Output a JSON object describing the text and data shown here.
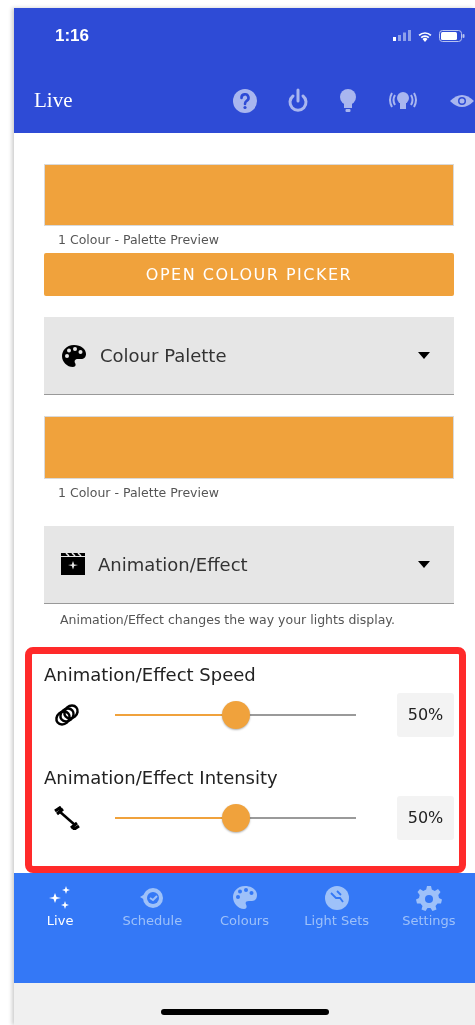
{
  "status_bar": {
    "time": "1:16"
  },
  "header": {
    "title": "Live"
  },
  "colour_preview": {
    "caption": "1 Colour - Palette Preview"
  },
  "colour_picker_button": {
    "label": "OPEN COLOUR PICKER"
  },
  "palette_dropdown": {
    "label": "Colour Palette"
  },
  "palette_preview": {
    "caption": "1 Colour - Palette Preview"
  },
  "effect_dropdown": {
    "label": "Animation/Effect",
    "helper": "Animation/Effect changes the way your lights display."
  },
  "sliders": [
    {
      "kind": "speed",
      "title": "Animation/Effect Speed",
      "level": 0.5,
      "reading": "50%"
    },
    {
      "kind": "intensity",
      "title": "Animation/Effect Intensity",
      "level": 0.5,
      "reading": "50%"
    }
  ],
  "tabs": [
    {
      "kind": "live",
      "label": "Live",
      "selected": true
    },
    {
      "kind": "schedule",
      "label": "Schedule",
      "selected": false
    },
    {
      "kind": "colours",
      "label": "Colours",
      "selected": false
    },
    {
      "kind": "lightsets",
      "label": "Light Sets",
      "selected": false
    },
    {
      "kind": "settings",
      "label": "Settings",
      "selected": false
    }
  ]
}
